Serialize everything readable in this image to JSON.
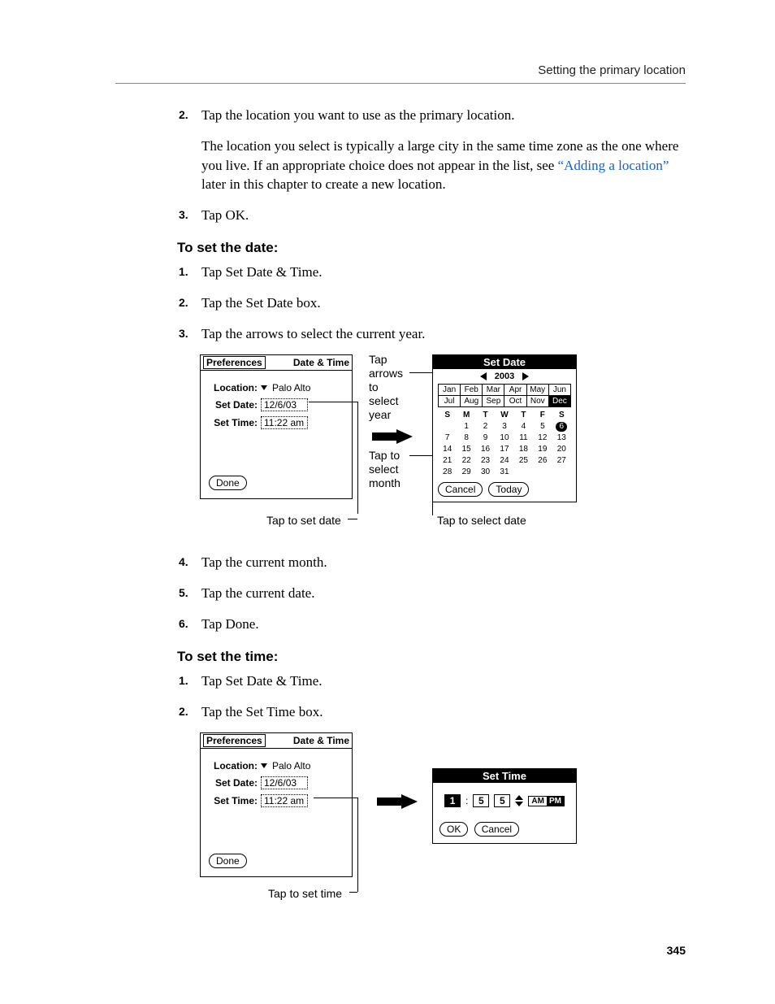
{
  "running_head": "Setting the primary location",
  "page_number": "345",
  "steps_top": [
    {
      "num": "2.",
      "paragraphs": [
        "Tap the location you want to use as the primary location.",
        "The location you select is typically a large city in the same time zone as the one where you live. If an appropriate choice does not appear in the list, see "
      ],
      "link_text": "“Adding a location”",
      "tail_text": " later in this chapter to create a new location."
    },
    {
      "num": "3.",
      "paragraphs": [
        "Tap OK."
      ]
    }
  ],
  "heading_date": "To set the date:",
  "steps_date_before": [
    {
      "num": "1.",
      "text": "Tap Set Date & Time."
    },
    {
      "num": "2.",
      "text": "Tap the Set Date box."
    },
    {
      "num": "3.",
      "text": "Tap the arrows to select the current year."
    }
  ],
  "steps_date_after": [
    {
      "num": "4.",
      "text": "Tap the current month."
    },
    {
      "num": "5.",
      "text": "Tap the current date."
    },
    {
      "num": "6.",
      "text": "Tap Done."
    }
  ],
  "heading_time": "To set the time:",
  "steps_time": [
    {
      "num": "1.",
      "text": "Tap Set Date & Time."
    },
    {
      "num": "2.",
      "text": "Tap the Set Time box."
    }
  ],
  "prefs_panel": {
    "title": "Preferences",
    "category": "Date & Time",
    "location_label": "Location:",
    "location_value": "Palo Alto",
    "setdate_label": "Set Date:",
    "setdate_value": "12/6/03",
    "settime_label": "Set Time:",
    "settime_value": "11:22 am",
    "done": "Done"
  },
  "callouts_fig1": {
    "tap_arrows": "Tap\narrows\nto\nselect\nyear",
    "tap_month": "Tap to\nselect\nmonth",
    "tap_set_date": "Tap to set date",
    "tap_select_date": "Tap to select date"
  },
  "date_panel": {
    "title": "Set Date",
    "year": "2003",
    "months": [
      "Jan",
      "Feb",
      "Mar",
      "Apr",
      "May",
      "Jun",
      "Jul",
      "Aug",
      "Sep",
      "Oct",
      "Nov",
      "Dec"
    ],
    "selected_month": "Dec",
    "dow": [
      "S",
      "M",
      "T",
      "W",
      "T",
      "F",
      "S"
    ],
    "weeks": [
      [
        "",
        "1",
        "2",
        "3",
        "4",
        "5",
        "6"
      ],
      [
        "7",
        "8",
        "9",
        "10",
        "11",
        "12",
        "13"
      ],
      [
        "14",
        "15",
        "16",
        "17",
        "18",
        "19",
        "20"
      ],
      [
        "21",
        "22",
        "23",
        "24",
        "25",
        "26",
        "27"
      ],
      [
        "28",
        "29",
        "30",
        "31",
        "",
        "",
        ""
      ]
    ],
    "selected_day": "6",
    "cancel": "Cancel",
    "today": "Today"
  },
  "callouts_fig2": {
    "tap_set_time": "Tap to set time"
  },
  "time_panel": {
    "title": "Set Time",
    "hour": "1",
    "min_tens": "5",
    "min_ones": "5",
    "am": "AM",
    "pm": "PM",
    "ok": "OK",
    "cancel": "Cancel"
  }
}
